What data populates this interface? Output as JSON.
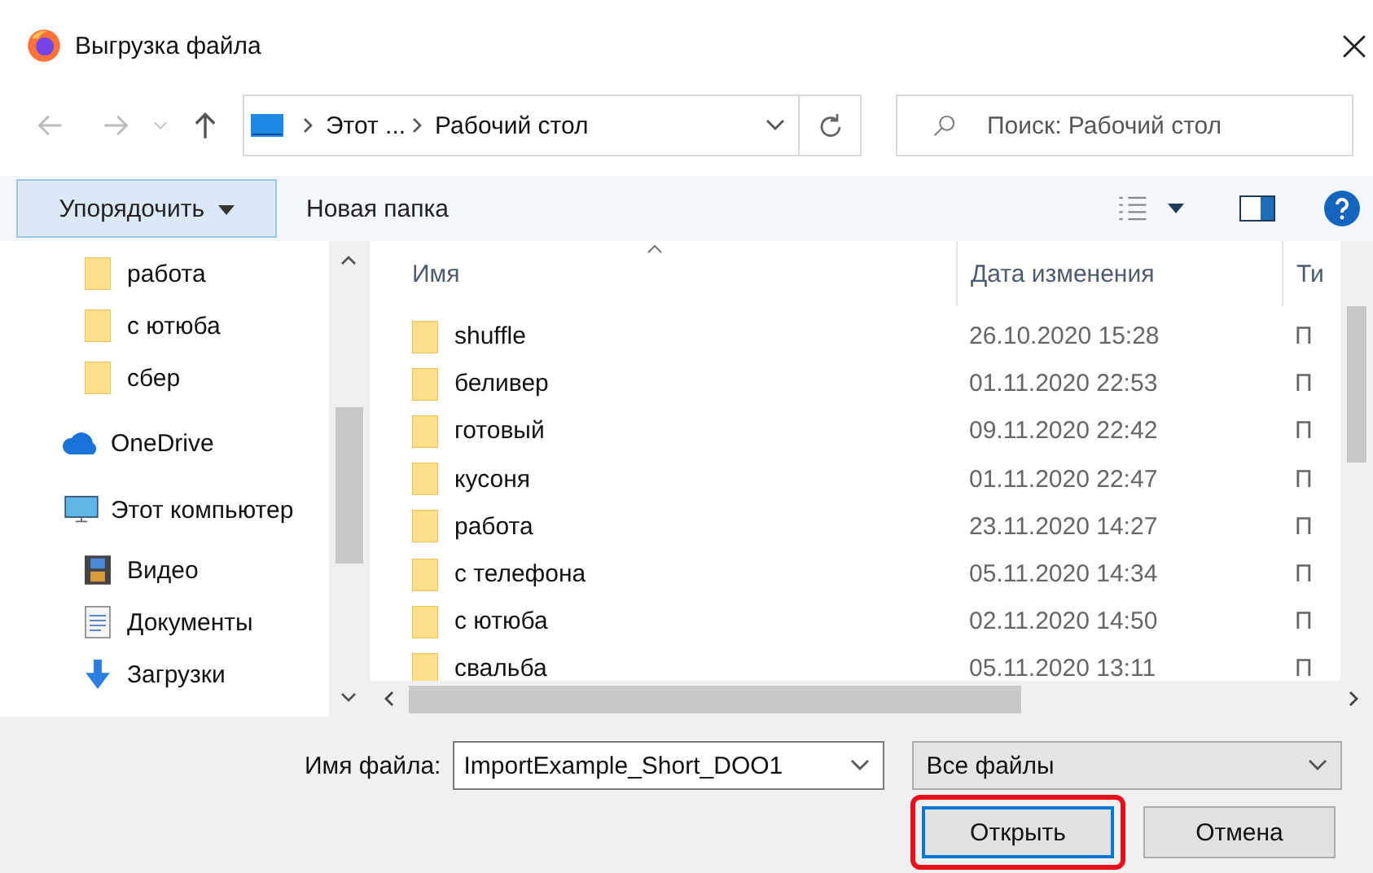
{
  "window": {
    "title": "Выгрузка файла"
  },
  "address": {
    "crumbs": [
      "Этот ...",
      "Рабочий стол"
    ]
  },
  "search": {
    "placeholder": "Поиск: Рабочий стол"
  },
  "toolbar": {
    "organize": "Упорядочить",
    "new_folder": "Новая папка"
  },
  "sidebar": {
    "items": [
      {
        "label": "работа",
        "kind": "folder"
      },
      {
        "label": "с ютюба",
        "kind": "folder"
      },
      {
        "label": "сбер",
        "kind": "folder"
      },
      {
        "label": "OneDrive",
        "kind": "cloud"
      },
      {
        "label": "Этот компьютер",
        "kind": "computer"
      },
      {
        "label": "Видео",
        "kind": "video"
      },
      {
        "label": "Документы",
        "kind": "documents"
      },
      {
        "label": "Загрузки",
        "kind": "downloads"
      }
    ]
  },
  "table": {
    "columns": [
      "Имя",
      "Дата изменения",
      "Ти"
    ],
    "rows": [
      {
        "name": "shuffle",
        "date": "26.10.2020 15:28",
        "column_3": "П"
      },
      {
        "name": "беливер",
        "date": "01.11.2020 22:53",
        "column_3": "П"
      },
      {
        "name": "готовый",
        "date": "09.11.2020 22:42",
        "column_3": "П"
      },
      {
        "name": "кусоня",
        "date": "01.11.2020 22:47",
        "column_3": "П"
      },
      {
        "name": "работа",
        "date": "23.11.2020 14:27",
        "column_3": "П"
      },
      {
        "name": "с телефона",
        "date": "05.11.2020 14:34",
        "column_3": "П"
      },
      {
        "name": "с ютюба",
        "date": "02.11.2020 14:50",
        "column_3": "П"
      },
      {
        "name": "свальба",
        "date": "05.11.2020 13:11",
        "column_3": "П"
      }
    ]
  },
  "footer": {
    "filename_label": "Имя файла:",
    "filename": "ImportExample_Short_DOO1",
    "filetype": "Все файлы",
    "open": "Открыть",
    "cancel": "Отмена",
    "open_highlighted": true
  }
}
